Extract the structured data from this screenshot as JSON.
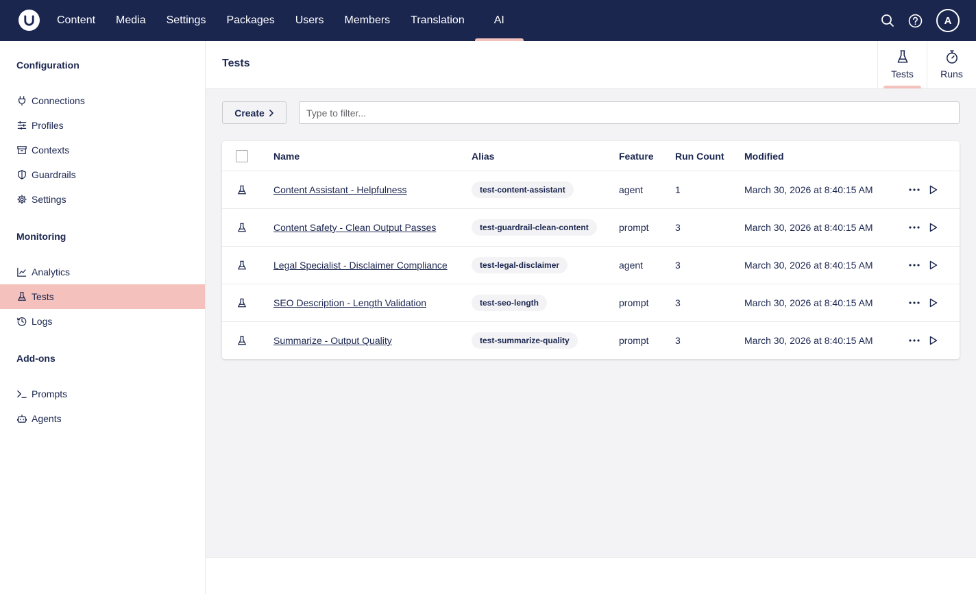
{
  "topbar": {
    "nav": [
      {
        "label": "Content"
      },
      {
        "label": "Media"
      },
      {
        "label": "Settings"
      },
      {
        "label": "Packages"
      },
      {
        "label": "Users"
      },
      {
        "label": "Members"
      },
      {
        "label": "Translation"
      },
      {
        "label": "AI",
        "active": true
      }
    ],
    "avatar_initial": "A",
    "icons": [
      "search-icon",
      "help-icon"
    ]
  },
  "sidebar": {
    "sections": [
      {
        "heading": "Configuration",
        "items": [
          {
            "label": "Connections",
            "icon": "plug-icon"
          },
          {
            "label": "Profiles",
            "icon": "sliders-icon"
          },
          {
            "label": "Contexts",
            "icon": "archive-icon"
          },
          {
            "label": "Guardrails",
            "icon": "shield-icon"
          },
          {
            "label": "Settings",
            "icon": "gear-icon"
          }
        ]
      },
      {
        "heading": "Monitoring",
        "items": [
          {
            "label": "Analytics",
            "icon": "chart-line-icon"
          },
          {
            "label": "Tests",
            "icon": "flask-icon",
            "active": true
          },
          {
            "label": "Logs",
            "icon": "history-icon"
          }
        ]
      },
      {
        "heading": "Add-ons",
        "items": [
          {
            "label": "Prompts",
            "icon": "terminal-icon"
          },
          {
            "label": "Agents",
            "icon": "bot-icon"
          }
        ]
      }
    ]
  },
  "main": {
    "title": "Tests",
    "view_tabs": [
      {
        "label": "Tests",
        "icon": "flask-icon",
        "active": true
      },
      {
        "label": "Runs",
        "icon": "stopwatch-icon"
      }
    ],
    "create_label": "Create",
    "filter_placeholder": "Type to filter...",
    "table": {
      "headers": {
        "name": "Name",
        "alias": "Alias",
        "feature": "Feature",
        "run_count": "Run Count",
        "modified": "Modified"
      },
      "rows": [
        {
          "name": "Content Assistant - Helpfulness",
          "alias": "test-content-assistant",
          "feature": "agent",
          "run_count": "1",
          "modified": "March 30, 2026 at 8:40:15 AM"
        },
        {
          "name": "Content Safety - Clean Output Passes",
          "alias": "test-guardrail-clean-content",
          "feature": "prompt",
          "run_count": "3",
          "modified": "March 30, 2026 at 8:40:15 AM"
        },
        {
          "name": "Legal Specialist - Disclaimer Compliance",
          "alias": "test-legal-disclaimer",
          "feature": "agent",
          "run_count": "3",
          "modified": "March 30, 2026 at 8:40:15 AM"
        },
        {
          "name": "SEO Description - Length Validation",
          "alias": "test-seo-length",
          "feature": "prompt",
          "run_count": "3",
          "modified": "March 30, 2026 at 8:40:15 AM"
        },
        {
          "name": "Summarize - Output Quality",
          "alias": "test-summarize-quality",
          "feature": "prompt",
          "run_count": "3",
          "modified": "March 30, 2026 at 8:40:15 AM"
        }
      ]
    }
  },
  "colors": {
    "topbar": "#1b264f",
    "accent": "#f5c1bc",
    "text": "#1b264f",
    "background": "#f3f3f5"
  }
}
